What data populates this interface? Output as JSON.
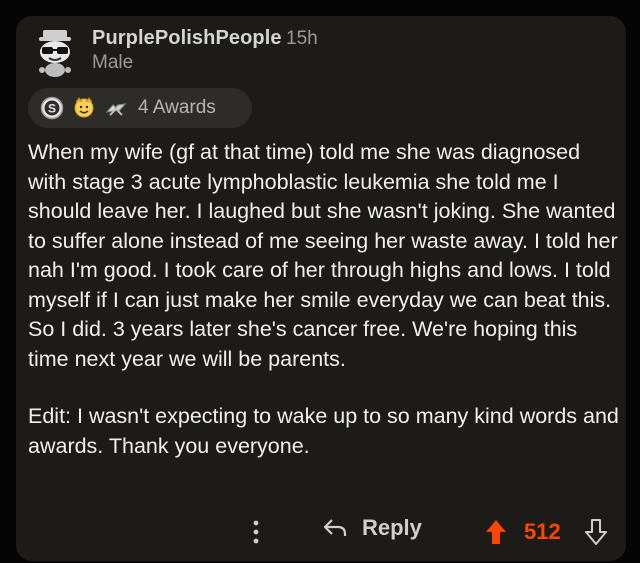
{
  "comment": {
    "username": "PurplePolishPeople",
    "time": "15h",
    "flair": "Male",
    "awards_label": "4 Awards",
    "award_icons": [
      "silver-award-icon",
      "wholesome-award-icon",
      "hands-award-icon"
    ],
    "body": [
      "When my wife (gf at that time) told me she was diagnosed with stage 3 acute lymphoblastic leukemia she told me I should leave her. I laughed but she wasn't joking. She wanted to suffer alone instead of me seeing her waste away. I told her nah I'm good. I took care of her through highs and lows. I told myself if I can just make her smile everyday we can beat this. So I did. 3 years later she's cancer free. We're hoping this time next year we will be parents.",
      "Edit: I wasn't expecting to wake up to so many kind words and awards. Thank you everyone."
    ]
  },
  "actions": {
    "reply_label": "Reply",
    "score": "512"
  },
  "colors": {
    "card_background": "#1c1b17",
    "upvote": "#ff4500",
    "text": "#f0f0f0",
    "muted": "#9a9a9a"
  }
}
